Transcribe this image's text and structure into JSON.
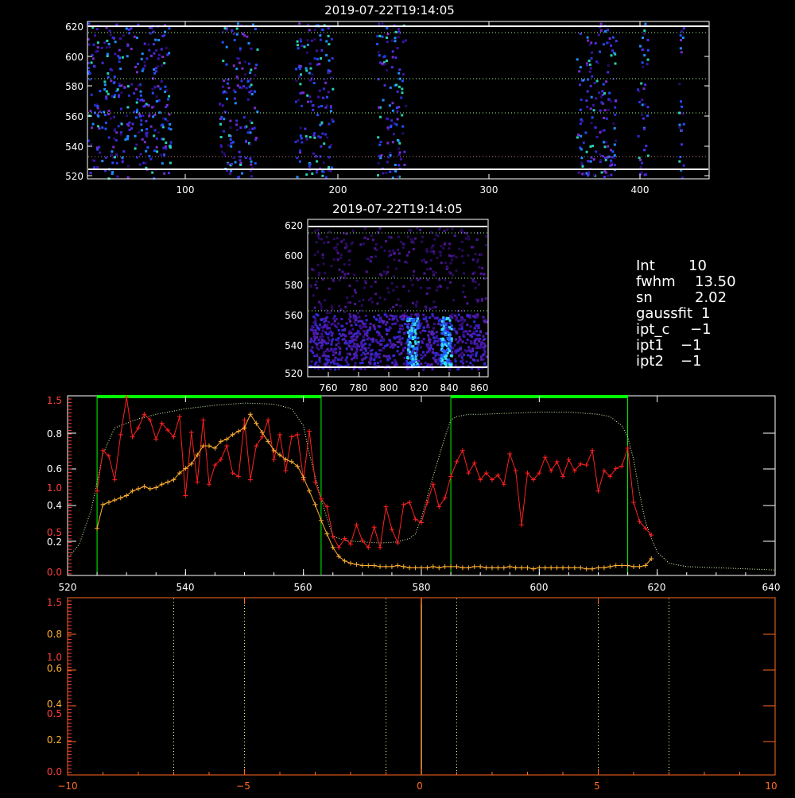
{
  "colors": {
    "background": "#000000",
    "frame": "#ffffff",
    "green_box": "#00ff00",
    "red_series": "#ff2020",
    "orange_series": "#ffb030",
    "dotted_profile": "#d8ffb0",
    "guide_line_red": "#c08080",
    "guide_line_green": "#a0ff90",
    "bottom_frame": "#ff6a20",
    "center_line": "#ffa040",
    "yellow_dots": "#ffff90",
    "left_axis_red": "#ff4040",
    "left_axis_orange": "#ffb030"
  },
  "panel_top": {
    "title": "2019-07-22T19:14:05",
    "x_ticks": [
      "100",
      "200",
      "300",
      "400"
    ],
    "y_ticks": [
      "620",
      "600",
      "580",
      "560",
      "540",
      "520"
    ],
    "bands_x": [
      [
        35,
        90
      ],
      [
        122,
        147
      ],
      [
        172,
        197
      ],
      [
        226,
        245
      ],
      [
        358,
        384
      ],
      [
        398,
        405
      ],
      [
        425,
        429
      ]
    ]
  },
  "panel_mid": {
    "title": "2019-07-22T19:14:05",
    "x_ticks": [
      "760",
      "780",
      "800",
      "820",
      "840",
      "860"
    ],
    "y_ticks": [
      "620",
      "600",
      "580",
      "560",
      "540",
      "520"
    ]
  },
  "info_box": {
    "lines": [
      {
        "label": "Int",
        "value": "10"
      },
      {
        "label": "fwhm",
        "value": "13.50"
      },
      {
        "label": "sn",
        "value": "2.02"
      },
      {
        "label": "gaussfit",
        "value": "1"
      },
      {
        "label": "ipt_c",
        "value": "−1"
      },
      {
        "label": "ipt1",
        "value": "−1"
      },
      {
        "label": "ipt2",
        "value": "−1"
      }
    ]
  },
  "panel_profile": {
    "x_ticks": [
      "520",
      "540",
      "560",
      "580",
      "600",
      "620",
      "640"
    ],
    "left_labels_white": [
      "0.8",
      "0.6",
      "0.4",
      "0.2"
    ],
    "left_labels_red": [
      "1.5",
      "1.0",
      "0.5",
      "0.0"
    ],
    "green_boxes_x": [
      [
        525,
        563
      ],
      [
        585,
        615
      ]
    ]
  },
  "panel_bottom": {
    "x_ticks": [
      "−10",
      "−5",
      "0",
      "5",
      "10"
    ],
    "left_labels_white": [
      "0.8",
      "0.6",
      "0.4",
      "0.2"
    ],
    "left_labels_red": [
      "1.5",
      "1.0",
      "0.5",
      "0.0"
    ],
    "dotted_lines_x": [
      -7,
      -5,
      -1,
      1,
      5,
      7
    ],
    "center_line_x": 0
  },
  "chart_data": [
    {
      "type": "line",
      "x_range": [
        520,
        640
      ],
      "y_range": [
        0,
        1.55
      ],
      "series": [
        {
          "x": [
            525,
            526,
            527,
            528,
            529,
            530,
            531,
            532,
            533,
            534,
            535,
            536,
            537,
            538,
            539,
            540,
            541,
            542,
            543,
            544,
            545,
            546,
            547,
            548,
            549,
            550,
            551,
            552,
            553,
            554,
            555,
            556,
            557,
            558,
            559,
            560,
            561,
            562,
            563,
            564,
            565,
            566,
            567,
            568,
            569,
            570,
            571,
            572,
            573,
            574,
            575,
            576,
            577,
            578,
            579,
            580,
            581,
            582,
            583,
            584,
            585,
            586,
            587,
            588,
            589,
            590,
            591,
            592,
            593,
            594,
            595,
            596,
            597,
            598,
            599,
            600,
            601,
            602,
            603,
            604,
            605,
            606,
            607,
            608,
            609,
            610,
            611,
            612,
            613,
            614,
            615,
            616,
            617,
            618,
            619
          ],
          "y": [
            0.72,
            1.08,
            1.03,
            0.82,
            1.22,
            1.55,
            1.2,
            1.28,
            1.4,
            1.35,
            1.18,
            1.32,
            1.26,
            1.2,
            1.38,
            0.68,
            1.24,
            0.8,
            1.35,
            0.78,
            0.95,
            1.0,
            1.12,
            0.88,
            0.85,
            1.35,
            0.82,
            1.12,
            1.2,
            1.35,
            1.0,
            1.22,
            0.9,
            1.2,
            1.22,
            0.82,
            1.25,
            0.8,
            0.65,
            0.58,
            0.32,
            0.22,
            0.3,
            0.25,
            0.42,
            0.28,
            0.22,
            0.4,
            0.22,
            0.58,
            0.38,
            0.26,
            0.6,
            0.62,
            0.47,
            0.44,
            0.62,
            0.78,
            0.58,
            0.66,
            0.85,
            0.98,
            1.08,
            0.88,
            0.97,
            0.82,
            0.88,
            0.82,
            0.86,
            0.78,
            1.05,
            0.9,
            0.42,
            0.88,
            0.82,
            0.88,
            1.02,
            0.9,
            0.98,
            0.85,
            1.0,
            0.9,
            0.96,
            0.95,
            1.08,
            0.72,
            0.9,
            0.85,
            0.92,
            0.94,
            1.1,
            0.62,
            0.45,
            0.39,
            0.33
          ]
        },
        {
          "x": [
            525,
            526,
            527,
            528,
            529,
            530,
            531,
            532,
            533,
            534,
            535,
            536,
            537,
            538,
            539,
            540,
            541,
            542,
            543,
            544,
            545,
            546,
            547,
            548,
            549,
            550,
            551,
            552,
            553,
            554,
            555,
            556,
            557,
            558,
            559,
            560,
            561,
            562,
            563,
            564,
            565,
            566,
            567,
            568,
            569,
            570,
            571,
            572,
            573,
            574,
            575,
            576,
            577,
            578,
            579,
            580,
            581,
            582,
            583,
            584,
            585,
            586,
            587,
            588,
            589,
            590,
            591,
            592,
            593,
            594,
            595,
            596,
            597,
            598,
            599,
            600,
            601,
            602,
            603,
            604,
            605,
            606,
            607,
            608,
            609,
            610,
            611,
            612,
            613,
            614,
            615,
            616,
            617,
            618,
            619
          ],
          "y": [
            0.39,
            0.6,
            0.62,
            0.64,
            0.66,
            0.68,
            0.72,
            0.74,
            0.76,
            0.74,
            0.75,
            0.78,
            0.8,
            0.82,
            0.88,
            0.92,
            0.96,
            1.04,
            1.12,
            1.12,
            1.1,
            1.16,
            1.18,
            1.22,
            1.25,
            1.28,
            1.4,
            1.32,
            1.24,
            1.16,
            1.08,
            1.04,
            1.0,
            0.98,
            0.94,
            0.84,
            0.72,
            0.6,
            0.46,
            0.34,
            0.22,
            0.14,
            0.1,
            0.08,
            0.07,
            0.06,
            0.06,
            0.06,
            0.05,
            0.05,
            0.05,
            0.06,
            0.05,
            0.04,
            0.04,
            0.04,
            0.04,
            0.05,
            0.04,
            0.05,
            0.05,
            0.05,
            0.04,
            0.04,
            0.05,
            0.05,
            0.04,
            0.04,
            0.04,
            0.04,
            0.05,
            0.04,
            0.04,
            0.04,
            0.03,
            0.04,
            0.04,
            0.04,
            0.04,
            0.04,
            0.04,
            0.04,
            0.04,
            0.03,
            0.03,
            0.04,
            0.04,
            0.05,
            0.06,
            0.06,
            0.06,
            0.05,
            0.05,
            0.06,
            0.12
          ]
        },
        {
          "x": [
            520,
            522,
            524,
            526,
            528,
            530,
            532,
            535,
            540,
            545,
            550,
            555,
            558,
            560,
            561,
            562,
            563,
            564,
            565,
            567,
            570,
            573,
            576,
            578,
            579,
            580,
            582,
            584,
            585,
            586,
            588,
            590,
            595,
            600,
            605,
            610,
            612,
            614,
            615,
            616,
            617,
            618,
            619,
            620,
            622,
            625,
            630,
            635,
            640
          ],
          "y": [
            0.12,
            0.25,
            0.55,
            1.05,
            1.28,
            1.32,
            1.36,
            1.4,
            1.45,
            1.48,
            1.5,
            1.49,
            1.45,
            1.3,
            1.05,
            0.85,
            0.65,
            0.48,
            0.32,
            0.28,
            0.27,
            0.26,
            0.27,
            0.3,
            0.34,
            0.48,
            0.85,
            1.2,
            1.35,
            1.38,
            1.4,
            1.4,
            1.41,
            1.42,
            1.42,
            1.4,
            1.38,
            1.3,
            1.2,
            1.0,
            0.7,
            0.45,
            0.3,
            0.18,
            0.08,
            0.05,
            0.04,
            0.03,
            0.02
          ]
        }
      ]
    }
  ]
}
